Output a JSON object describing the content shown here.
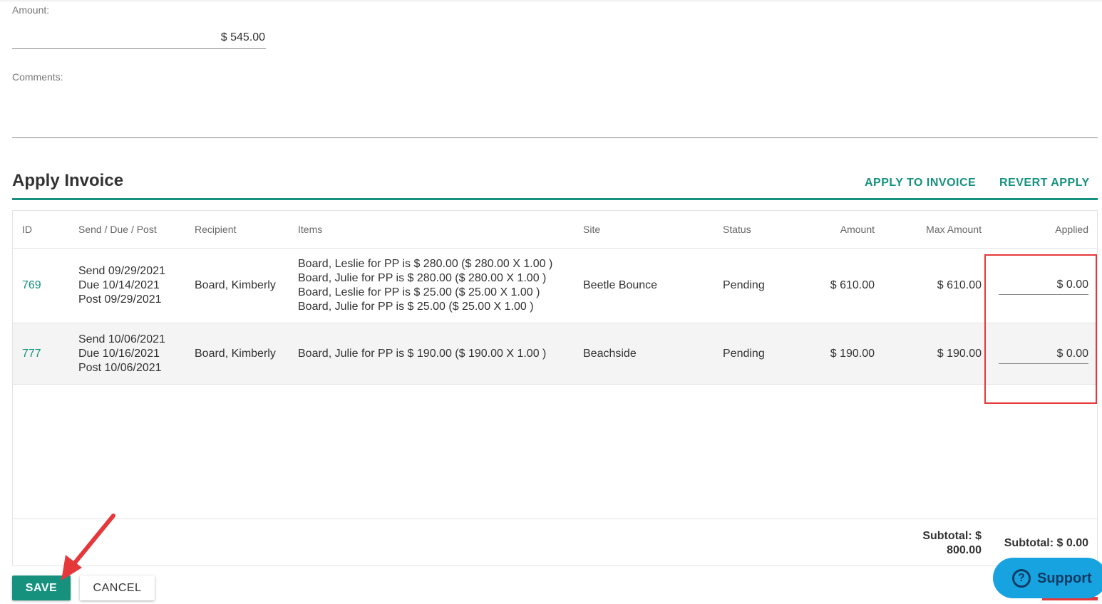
{
  "form": {
    "amount_label": "Amount:",
    "amount_value": "$ 545.00",
    "comments_label": "Comments:",
    "comments_value": ""
  },
  "apply_invoice": {
    "title": "Apply Invoice",
    "apply_button": "APPLY TO INVOICE",
    "revert_button": "REVERT APPLY",
    "columns": [
      "ID",
      "Send / Due / Post",
      "Recipient",
      "Items",
      "Site",
      "Status",
      "Amount",
      "Max Amount",
      "Applied"
    ],
    "rows": [
      {
        "id": "769",
        "send": "Send 09/29/2021",
        "due": "Due 10/14/2021",
        "post": "Post 09/29/2021",
        "recipient": "Board, Kimberly",
        "items": [
          "Board, Leslie for PP is $ 280.00 ($ 280.00 X 1.00 )",
          "Board, Julie for PP is $ 280.00 ($ 280.00 X 1.00 )",
          "Board, Leslie for PP is $ 25.00 ($ 25.00 X 1.00 )",
          "Board, Julie for PP is $ 25.00 ($ 25.00 X 1.00 )"
        ],
        "site": "Beetle Bounce",
        "status": "Pending",
        "amount": "$ 610.00",
        "max_amount": "$ 610.00",
        "applied": "$ 0.00"
      },
      {
        "id": "777",
        "send": "Send 10/06/2021",
        "due": "Due 10/16/2021",
        "post": "Post 10/06/2021",
        "recipient": "Board, Kimberly",
        "items": [
          "Board, Julie for PP is $ 190.00 ($ 190.00 X 1.00 )"
        ],
        "site": "Beachside",
        "status": "Pending",
        "amount": "$ 190.00",
        "max_amount": "$ 190.00",
        "applied": "$ 0.00"
      }
    ],
    "subtotal_max_line1": "Subtotal: $",
    "subtotal_max_line2": "800.00",
    "subtotal_applied": "Subtotal: $ 0.00"
  },
  "actions": {
    "save_label": "SAVE",
    "cancel_label": "CANCEL"
  },
  "support": {
    "icon": "question-circle-icon",
    "label": "Support"
  },
  "colors": {
    "accent": "#15917e",
    "highlight": "#e5383b",
    "support_bg": "#17a2e0",
    "support_text": "#0f3b63"
  }
}
